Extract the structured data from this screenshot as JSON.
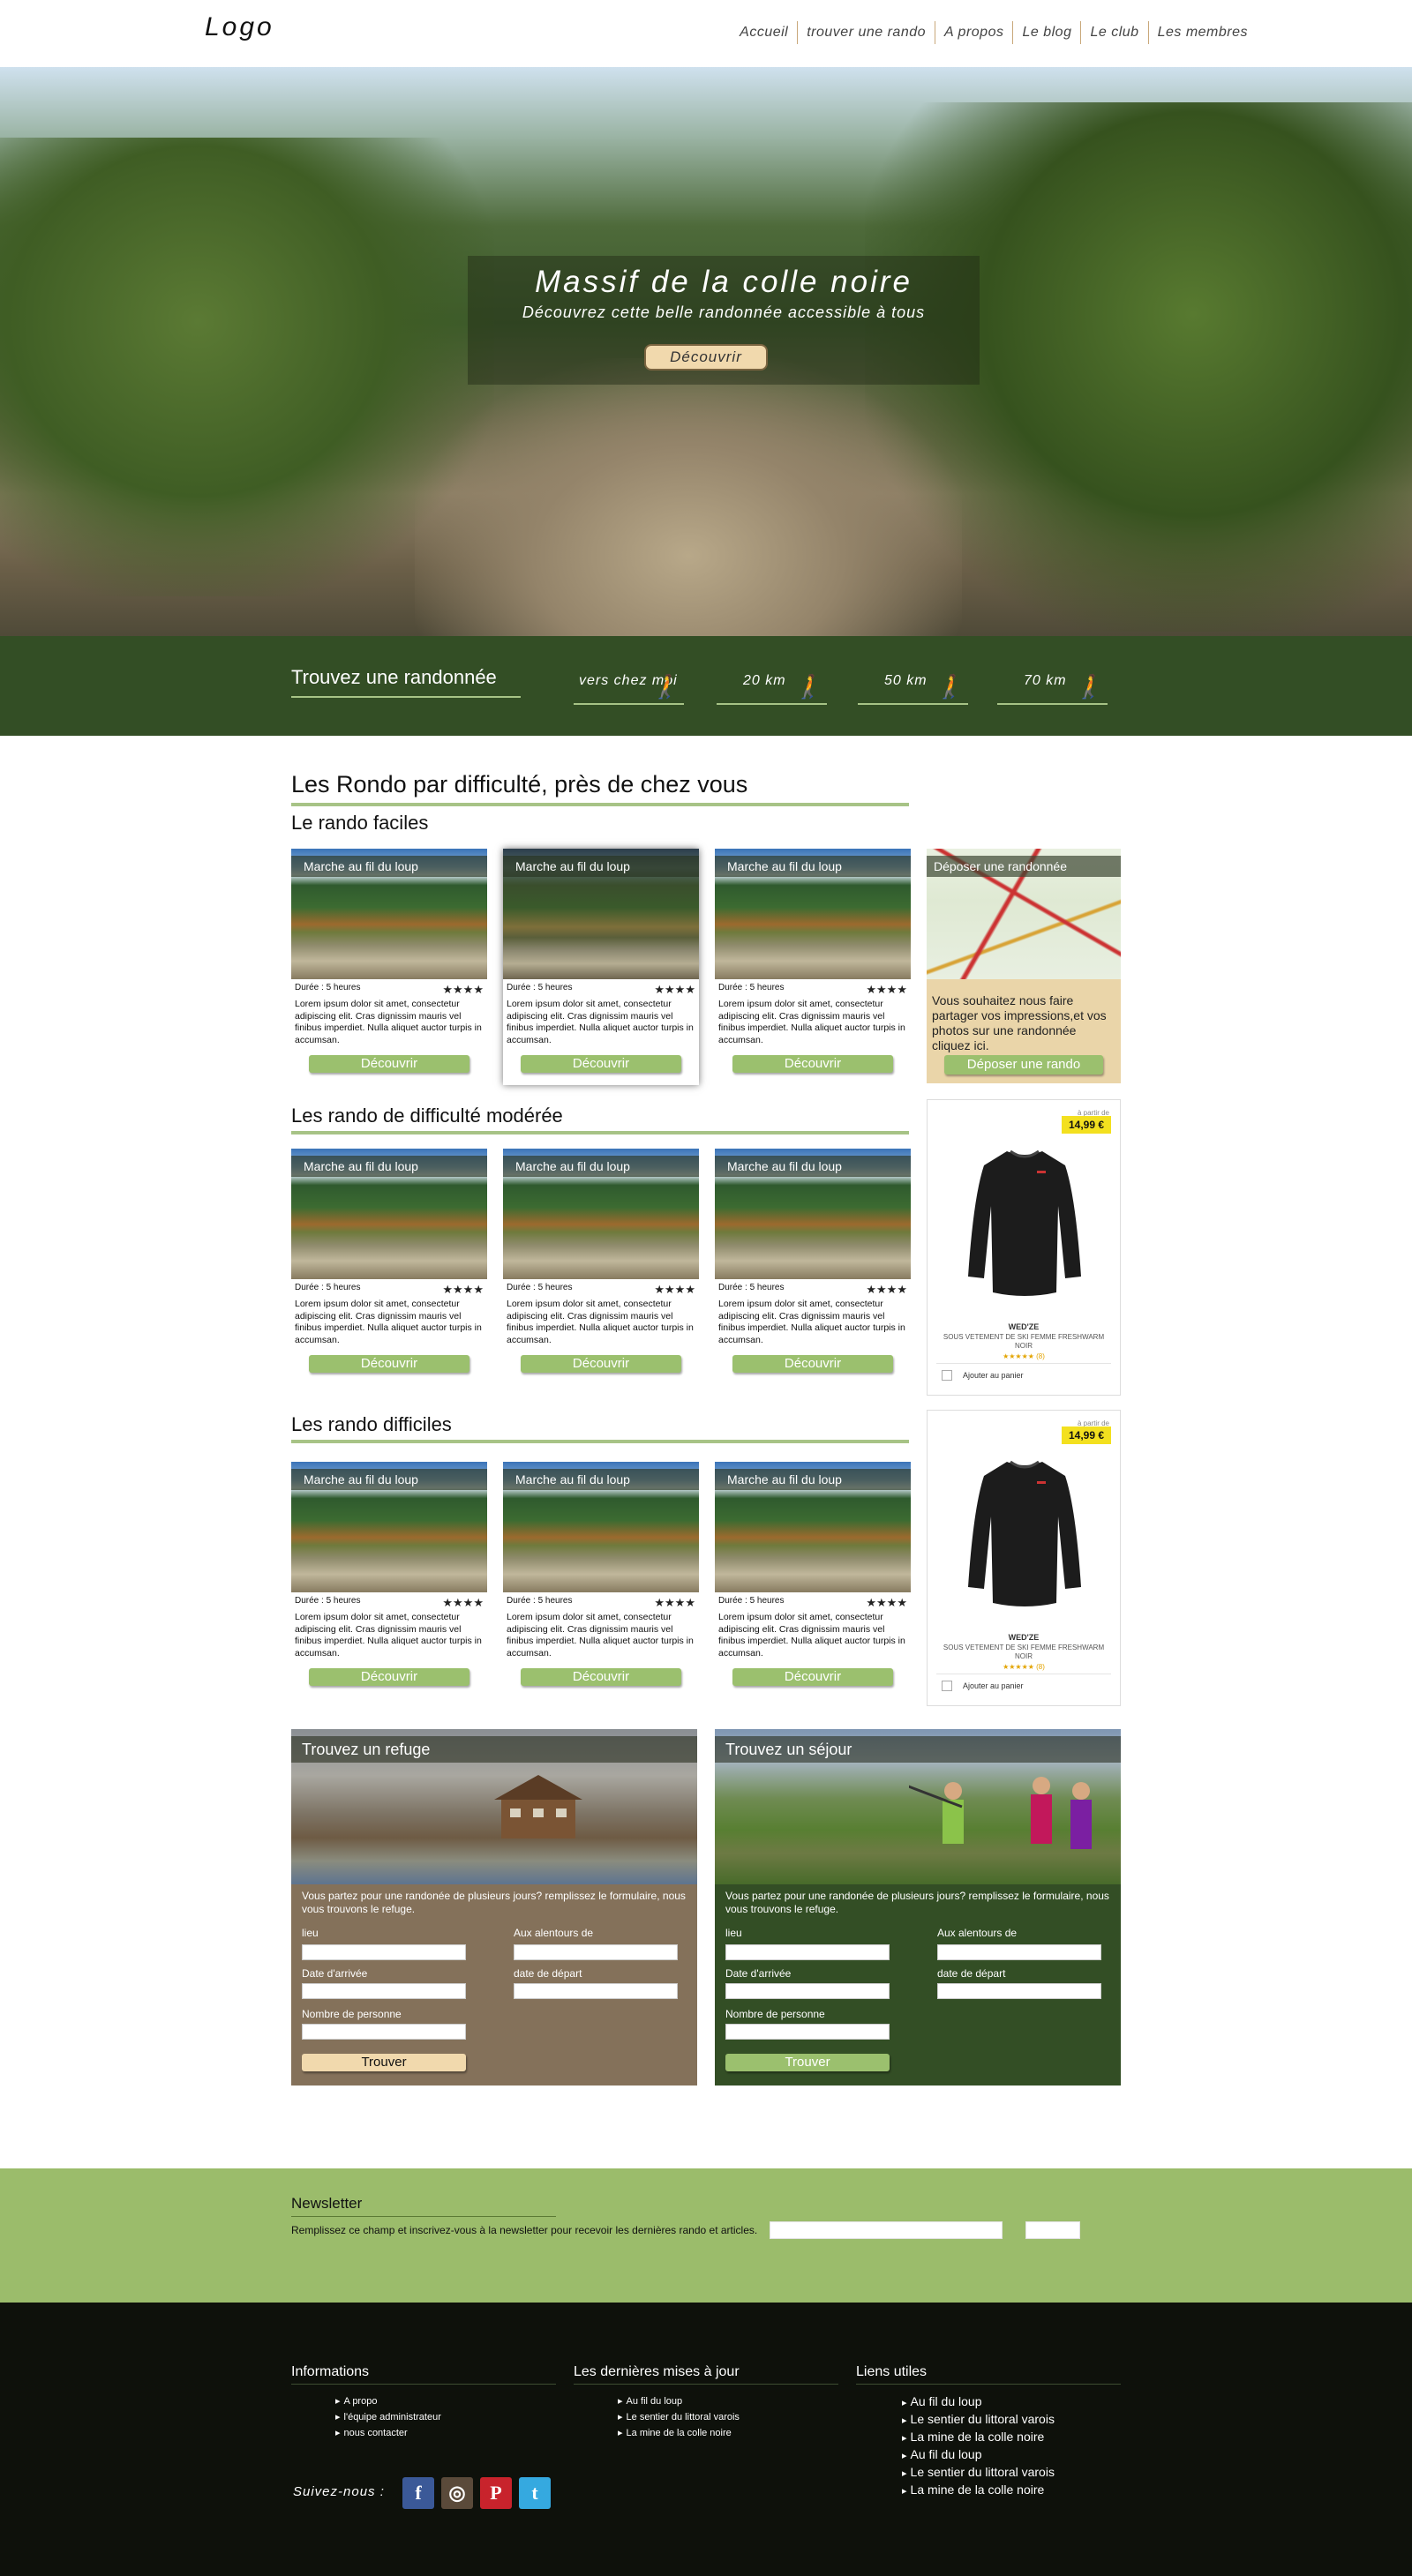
{
  "header": {
    "logo": "Logo",
    "nav": [
      "Accueil",
      "trouver une rando",
      "A propos",
      "Le blog",
      "Le club",
      "Les membres"
    ]
  },
  "hero": {
    "title": "Massif de la colle noire",
    "subtitle": "Découvrez cette belle randonnée accessible à tous",
    "button": "Découvrir"
  },
  "search": {
    "title": "Trouvez une randonnée",
    "options": [
      "vers chez moi",
      "20 km",
      "50 km",
      "70 km"
    ]
  },
  "main": {
    "section_title": "Les Rondo par difficulté, près de chez vous",
    "categories": [
      "Le rando faciles",
      "Les rando de difficulté modérée",
      "Les rando difficiles"
    ],
    "card": {
      "label": "Marche au fil du loup",
      "duration": "Durée : 5 heures",
      "stars": "★★★★",
      "text": "Lorem ipsum dolor sit amet, consectetur adipiscing elit. Cras dignissim mauris vel finibus imperdiet. Nulla aliquet auctor turpis in accumsan.",
      "button": "Découvrir"
    },
    "promo": {
      "label": "Déposer une randonnée",
      "text": "Vous souhaitez nous faire partager vos impressions,et vos photos sur une randonnée cliquez ici.",
      "button": "Déposer une rando"
    },
    "ad": {
      "from": "à partir de",
      "price": "14,99 €",
      "brand": "WED'ZE",
      "name": "SOUS VETEMENT DE SKI FEMME FRESHWARM NOIR",
      "rating": "★★★★★ (8)",
      "cart": "Ajouter au panier"
    }
  },
  "forms": {
    "refuge": {
      "title": "Trouvez un refuge",
      "intro": "Vous partez pour une randonée de plusieurs jours? remplissez le formulaire, nous vous trouvons le refuge.",
      "button": "Trouver"
    },
    "sejour": {
      "title": "Trouvez un séjour",
      "intro": "Vous partez pour une randonée de plusieurs jours? remplissez le formulaire, nous vous trouvons le refuge.",
      "button": "Trouver"
    },
    "fields": {
      "lieu": "lieu",
      "alentours": "Aux alentours de",
      "arrivee": "Date d'arrivée",
      "depart": "date de départ",
      "personnes": "Nombre de personne"
    }
  },
  "newsletter": {
    "title": "Newsletter",
    "text": "Remplissez ce champ et inscrivez-vous à la newsletter pour recevoir les dernières rando et articles."
  },
  "footer": {
    "informations": {
      "title": "Informations",
      "items": [
        "A propo",
        "l'équipe administrateur",
        "nous contacter"
      ]
    },
    "updates": {
      "title": "Les dernières mises à jour",
      "items": [
        "Au fil du loup",
        "Le sentier du  littoral varois",
        "La mine de la colle noire"
      ]
    },
    "links": {
      "title": "Liens utiles",
      "items": [
        "Au fil du loup",
        "Le sentier du  littoral varois",
        "La mine de la colle noire",
        "Au fil du loup",
        "Le sentier du  littoral varois",
        "La mine de la colle noire"
      ]
    },
    "follow": "Suivez-nous :",
    "social": [
      {
        "icon": "facebook-icon",
        "glyph": "f",
        "color": "#3b5998"
      },
      {
        "icon": "instagram-icon",
        "glyph": "◎",
        "color": "#5a4a3a"
      },
      {
        "icon": "pinterest-icon",
        "glyph": "P",
        "color": "#c8232c"
      },
      {
        "icon": "twitter-icon",
        "glyph": "t",
        "color": "#35a9e0"
      }
    ]
  }
}
